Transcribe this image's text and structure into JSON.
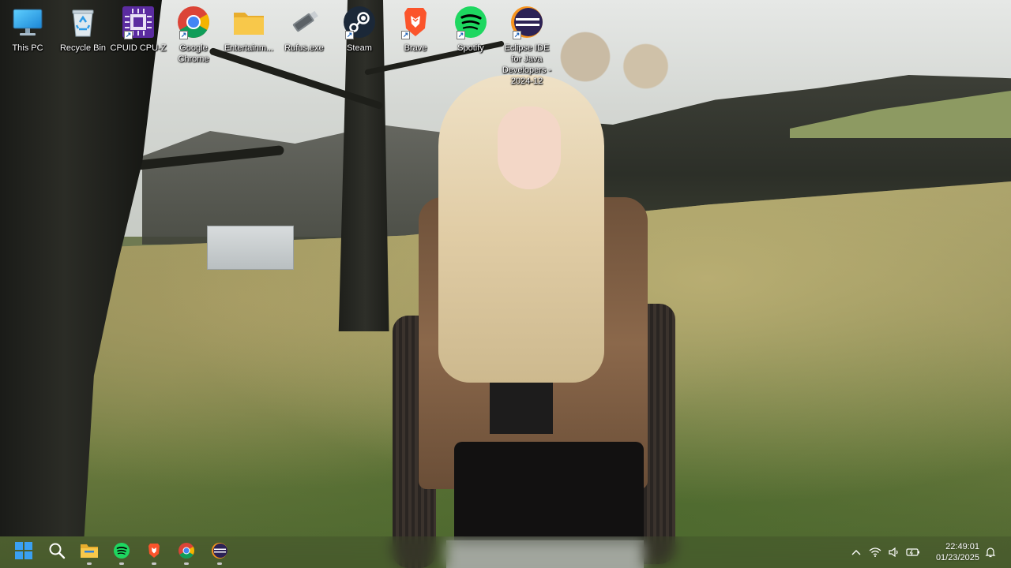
{
  "desktop": {
    "icons": [
      {
        "label": "This PC",
        "icon": "monitor-icon"
      },
      {
        "label": "Recycle Bin",
        "icon": "recycle-bin-icon"
      },
      {
        "label": "CPUID CPU-Z",
        "icon": "cpu-z-icon"
      },
      {
        "label": "Google Chrome",
        "icon": "chrome-icon"
      },
      {
        "label": "Entertainm...",
        "icon": "folder-icon"
      },
      {
        "label": "Rufus.exe",
        "icon": "rufus-icon"
      },
      {
        "label": "Steam",
        "icon": "steam-icon"
      },
      {
        "label": "Brave",
        "icon": "brave-icon"
      },
      {
        "label": "Spotify",
        "icon": "spotify-icon"
      },
      {
        "label": "Eclipse IDE for Java Developers - 2024-12",
        "icon": "eclipse-icon"
      }
    ]
  },
  "taskbar": {
    "pinned": [
      {
        "name": "Start",
        "icon": "windows-start-icon"
      },
      {
        "name": "Search",
        "icon": "search-icon"
      },
      {
        "name": "File Explorer",
        "icon": "file-explorer-icon"
      },
      {
        "name": "Spotify",
        "icon": "spotify-icon"
      },
      {
        "name": "Brave",
        "icon": "brave-icon"
      },
      {
        "name": "Google Chrome",
        "icon": "chrome-icon"
      },
      {
        "name": "Eclipse IDE",
        "icon": "eclipse-icon"
      }
    ],
    "tray": {
      "icons": [
        "chevron-up-icon",
        "wifi-icon",
        "volume-icon",
        "battery-icon",
        "notification-bell-icon"
      ],
      "time": "22:49:01",
      "date": "01/23/2025"
    }
  },
  "colors": {
    "chrome_red": "#db4437",
    "chrome_yellow": "#f4b400",
    "chrome_green": "#0f9d58",
    "chrome_blue": "#4285f4",
    "spotify_green": "#1ed760",
    "brave_orange": "#fb542b",
    "steam_blue": "#1b2838",
    "cpuz_purple": "#5b2ca0",
    "eclipse_navy": "#2c2255",
    "folder_yellow": "#f8c84a",
    "windows_blue": "#3aa0f3"
  }
}
